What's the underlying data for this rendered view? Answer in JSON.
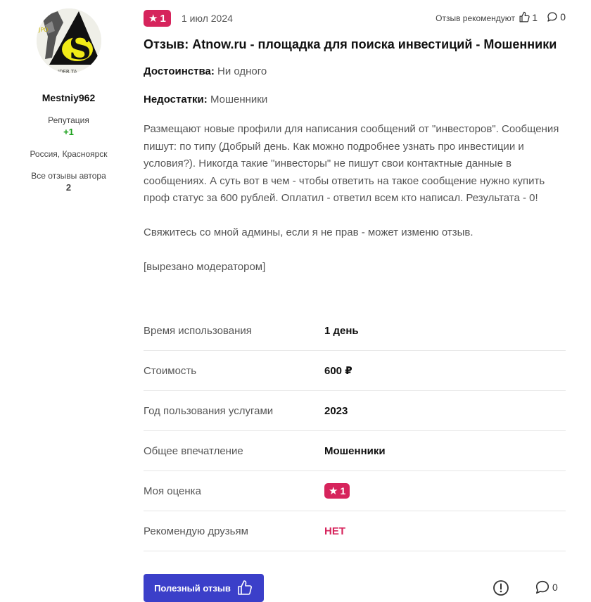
{
  "author": {
    "username": "Mestniy962",
    "reputation_label": "Репутация",
    "reputation_value": "+1",
    "location": "Россия, Красноярск",
    "all_reviews_label": "Все отзывы автора",
    "all_reviews_count": "2"
  },
  "review": {
    "rating": "1",
    "date": "1 июл 2024",
    "recommend_label": "Отзыв рекомендуют",
    "likes": "1",
    "comments": "0",
    "title": "Отзыв: Atnow.ru - площадка для поиска инвестиций - Мошенники",
    "pros_label": "Достоинства:",
    "pros_value": "Ни одного",
    "cons_label": "Недостатки:",
    "cons_value": "Мошенники",
    "body_p1": "Размещают новые профили для написания сообщений от \"инвесторов\". Сообщения пишут: по типу (Добрый день. Как можно подробнее узнать про инвестиции и условия?). Никогда такие \"инвесторы\" не пишут свои контактные данные в сообщениях. А суть вот в чем - чтобы ответить на такое сообщение нужно купить проф статус за 600 рублей. Оплатил - ответил всем кто написал. Результата - 0!",
    "body_p2": "Свяжитесь со мной админы, если я не прав - может изменю отзыв.",
    "body_p3": "[вырезано модератором]"
  },
  "details": [
    {
      "label": "Время использования",
      "value": "1 день"
    },
    {
      "label": "Стоимость",
      "value": "600 ₽"
    },
    {
      "label": "Год пользования услугами",
      "value": "2023"
    },
    {
      "label": "Общее впечатление",
      "value": "Мошенники"
    },
    {
      "label": "Моя оценка",
      "value": "1"
    },
    {
      "label": "Рекомендую друзьям",
      "value": "НЕТ"
    }
  ],
  "footer": {
    "helpful_label": "Полезный отзыв",
    "comments": "0"
  },
  "colors": {
    "accent": "#d6245c",
    "button": "#3b3fc9",
    "reputation": "#1aa01a"
  },
  "icons": [
    "star-icon",
    "thumbs-up-icon",
    "comment-icon",
    "report-icon"
  ]
}
